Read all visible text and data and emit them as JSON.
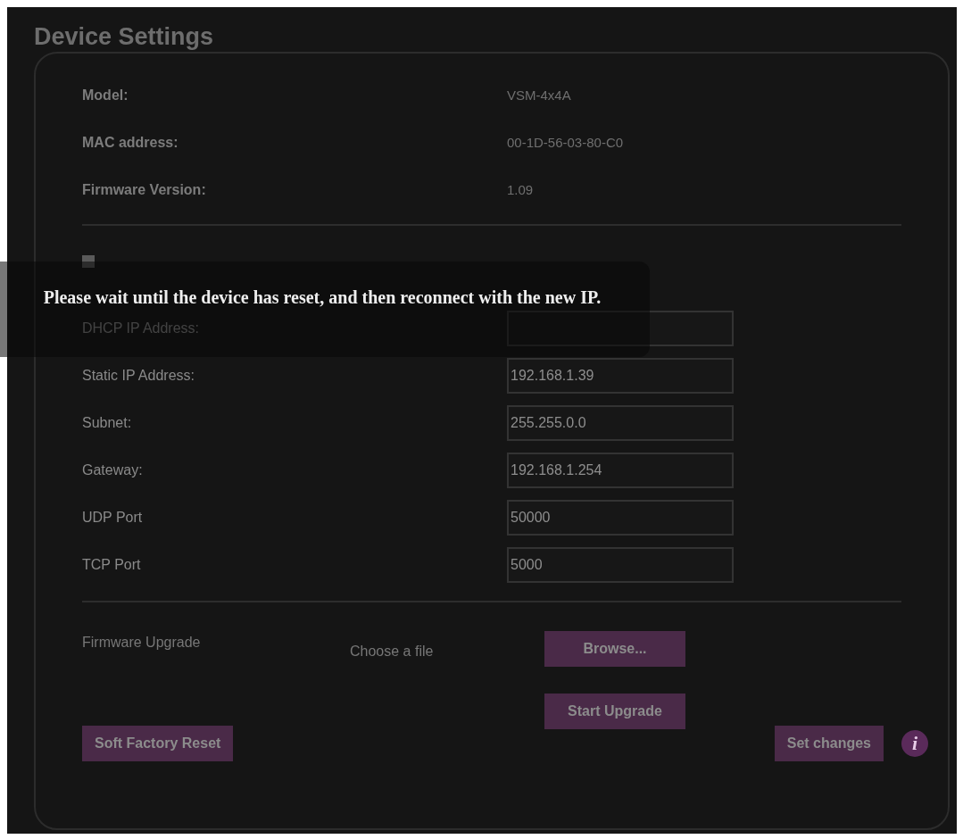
{
  "title": "Device Settings",
  "info": [
    {
      "label": "Model:",
      "value": "VSM-4x4A"
    },
    {
      "label": "MAC address:",
      "value": "00-1D-56-03-80-C0"
    },
    {
      "label": "Firmware Version:",
      "value": "1.09"
    }
  ],
  "dhcp": {
    "checked": false
  },
  "fields": [
    {
      "label": "DHCP IP Address:"
    },
    {
      "label": "Static IP Address:",
      "value": "192.168.1.39"
    },
    {
      "label": "Subnet:",
      "value": "255.255.0.0"
    },
    {
      "label": "Gateway:",
      "value": "192.168.1.254"
    },
    {
      "label": "UDP Port",
      "value": "50000"
    },
    {
      "label": "TCP Port",
      "value": "5000"
    }
  ],
  "firmware": {
    "label": "Firmware Upgrade",
    "file_hint": "Choose a file",
    "browse": "Browse...",
    "start": "Start Upgrade"
  },
  "reset_button": "Soft Factory Reset",
  "set_button": "Set changes",
  "info_icon": "i",
  "message": "Please wait until the device has reset, and then reconnect with the new IP."
}
